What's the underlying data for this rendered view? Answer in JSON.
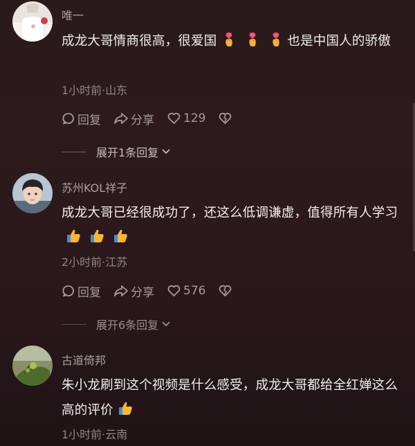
{
  "comments": [
    {
      "username": "唯一",
      "text_before": "成龙大哥情商很高，很爱国",
      "emoji": [
        "finger-heart",
        "finger-heart",
        "finger-heart"
      ],
      "text_after": "也是中国人的骄傲",
      "meta": "1小时前·山东",
      "reply_label": "回复",
      "share_label": "分享",
      "likes": "129",
      "expand_label": "展开1条回复"
    },
    {
      "username": "苏州KOL祥子",
      "text_before": "成龙大哥已经很成功了，还这么低调谦虚，值得所有人学习",
      "emoji": [
        "thumbs-up",
        "thumbs-up",
        "thumbs-up"
      ],
      "text_after": "",
      "meta": "2小时前·江苏",
      "reply_label": "回复",
      "share_label": "分享",
      "likes": "576",
      "expand_label": "展开6条回复"
    },
    {
      "username": "古道倚邦",
      "text_before": "朱小龙刷到这个视频是什么感受，成龙大哥都给全红婵这么高的评价",
      "emoji": [
        "thumbs-up"
      ],
      "text_after": "",
      "meta": "1小时前·云南"
    }
  ],
  "colors": {
    "background": "#2b1a1c",
    "text": "#f1eeee",
    "muted": "#8f8688",
    "username": "#a9a0a2"
  },
  "icons": [
    "reply-icon",
    "share-icon",
    "heart-icon",
    "dislike-heart-icon",
    "chevron-down-icon",
    "finger-heart-emoji",
    "thumbs-up-emoji"
  ]
}
